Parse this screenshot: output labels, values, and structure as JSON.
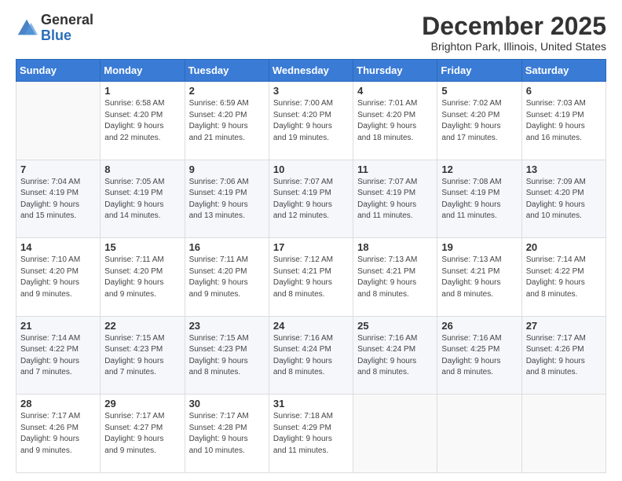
{
  "logo": {
    "line1": "General",
    "line2": "Blue"
  },
  "header": {
    "title": "December 2025",
    "location": "Brighton Park, Illinois, United States"
  },
  "weekdays": [
    "Sunday",
    "Monday",
    "Tuesday",
    "Wednesday",
    "Thursday",
    "Friday",
    "Saturday"
  ],
  "weeks": [
    [
      {
        "day": "",
        "info": ""
      },
      {
        "day": "1",
        "info": "Sunrise: 6:58 AM\nSunset: 4:20 PM\nDaylight: 9 hours\nand 22 minutes."
      },
      {
        "day": "2",
        "info": "Sunrise: 6:59 AM\nSunset: 4:20 PM\nDaylight: 9 hours\nand 21 minutes."
      },
      {
        "day": "3",
        "info": "Sunrise: 7:00 AM\nSunset: 4:20 PM\nDaylight: 9 hours\nand 19 minutes."
      },
      {
        "day": "4",
        "info": "Sunrise: 7:01 AM\nSunset: 4:20 PM\nDaylight: 9 hours\nand 18 minutes."
      },
      {
        "day": "5",
        "info": "Sunrise: 7:02 AM\nSunset: 4:20 PM\nDaylight: 9 hours\nand 17 minutes."
      },
      {
        "day": "6",
        "info": "Sunrise: 7:03 AM\nSunset: 4:19 PM\nDaylight: 9 hours\nand 16 minutes."
      }
    ],
    [
      {
        "day": "7",
        "info": "Sunrise: 7:04 AM\nSunset: 4:19 PM\nDaylight: 9 hours\nand 15 minutes."
      },
      {
        "day": "8",
        "info": "Sunrise: 7:05 AM\nSunset: 4:19 PM\nDaylight: 9 hours\nand 14 minutes."
      },
      {
        "day": "9",
        "info": "Sunrise: 7:06 AM\nSunset: 4:19 PM\nDaylight: 9 hours\nand 13 minutes."
      },
      {
        "day": "10",
        "info": "Sunrise: 7:07 AM\nSunset: 4:19 PM\nDaylight: 9 hours\nand 12 minutes."
      },
      {
        "day": "11",
        "info": "Sunrise: 7:07 AM\nSunset: 4:19 PM\nDaylight: 9 hours\nand 11 minutes."
      },
      {
        "day": "12",
        "info": "Sunrise: 7:08 AM\nSunset: 4:19 PM\nDaylight: 9 hours\nand 11 minutes."
      },
      {
        "day": "13",
        "info": "Sunrise: 7:09 AM\nSunset: 4:20 PM\nDaylight: 9 hours\nand 10 minutes."
      }
    ],
    [
      {
        "day": "14",
        "info": "Sunrise: 7:10 AM\nSunset: 4:20 PM\nDaylight: 9 hours\nand 9 minutes."
      },
      {
        "day": "15",
        "info": "Sunrise: 7:11 AM\nSunset: 4:20 PM\nDaylight: 9 hours\nand 9 minutes."
      },
      {
        "day": "16",
        "info": "Sunrise: 7:11 AM\nSunset: 4:20 PM\nDaylight: 9 hours\nand 9 minutes."
      },
      {
        "day": "17",
        "info": "Sunrise: 7:12 AM\nSunset: 4:21 PM\nDaylight: 9 hours\nand 8 minutes."
      },
      {
        "day": "18",
        "info": "Sunrise: 7:13 AM\nSunset: 4:21 PM\nDaylight: 9 hours\nand 8 minutes."
      },
      {
        "day": "19",
        "info": "Sunrise: 7:13 AM\nSunset: 4:21 PM\nDaylight: 9 hours\nand 8 minutes."
      },
      {
        "day": "20",
        "info": "Sunrise: 7:14 AM\nSunset: 4:22 PM\nDaylight: 9 hours\nand 8 minutes."
      }
    ],
    [
      {
        "day": "21",
        "info": "Sunrise: 7:14 AM\nSunset: 4:22 PM\nDaylight: 9 hours\nand 7 minutes."
      },
      {
        "day": "22",
        "info": "Sunrise: 7:15 AM\nSunset: 4:23 PM\nDaylight: 9 hours\nand 7 minutes."
      },
      {
        "day": "23",
        "info": "Sunrise: 7:15 AM\nSunset: 4:23 PM\nDaylight: 9 hours\nand 8 minutes."
      },
      {
        "day": "24",
        "info": "Sunrise: 7:16 AM\nSunset: 4:24 PM\nDaylight: 9 hours\nand 8 minutes."
      },
      {
        "day": "25",
        "info": "Sunrise: 7:16 AM\nSunset: 4:24 PM\nDaylight: 9 hours\nand 8 minutes."
      },
      {
        "day": "26",
        "info": "Sunrise: 7:16 AM\nSunset: 4:25 PM\nDaylight: 9 hours\nand 8 minutes."
      },
      {
        "day": "27",
        "info": "Sunrise: 7:17 AM\nSunset: 4:26 PM\nDaylight: 9 hours\nand 8 minutes."
      }
    ],
    [
      {
        "day": "28",
        "info": "Sunrise: 7:17 AM\nSunset: 4:26 PM\nDaylight: 9 hours\nand 9 minutes."
      },
      {
        "day": "29",
        "info": "Sunrise: 7:17 AM\nSunset: 4:27 PM\nDaylight: 9 hours\nand 9 minutes."
      },
      {
        "day": "30",
        "info": "Sunrise: 7:17 AM\nSunset: 4:28 PM\nDaylight: 9 hours\nand 10 minutes."
      },
      {
        "day": "31",
        "info": "Sunrise: 7:18 AM\nSunset: 4:29 PM\nDaylight: 9 hours\nand 11 minutes."
      },
      {
        "day": "",
        "info": ""
      },
      {
        "day": "",
        "info": ""
      },
      {
        "day": "",
        "info": ""
      }
    ]
  ]
}
